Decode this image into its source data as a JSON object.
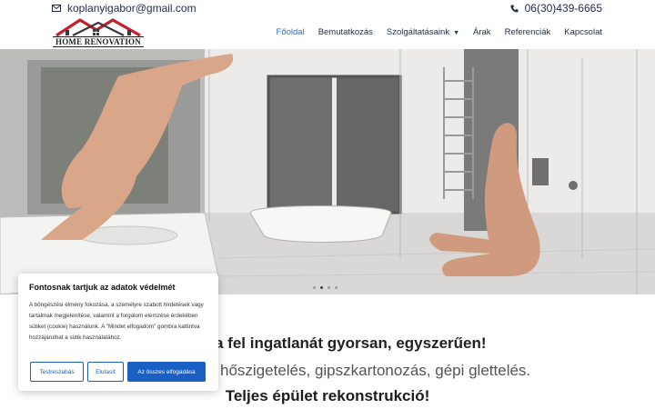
{
  "topbar": {
    "email": "koplanyigabor@gmail.com",
    "email_icon": "envelope-icon",
    "phone": "06(30)439-6665",
    "phone_icon": "phone-icon"
  },
  "logo": {
    "text": "HOME RENOVATION"
  },
  "nav": {
    "items": [
      {
        "label": "Főoldal",
        "active": true
      },
      {
        "label": "Bemutatkozás"
      },
      {
        "label": "Szolgáltatásaink",
        "has_dropdown": true
      },
      {
        "label": "Árak"
      },
      {
        "label": "Referenciák"
      },
      {
        "label": "Kapcsolat"
      }
    ]
  },
  "hero": {
    "slides": 4,
    "active_slide": 2
  },
  "tagline": {
    "line1": "a fel ingatlanát gyorsan, egyszerűen!",
    "line2": "hőszigetelés, gipszkartonozás, gépi glettelés.",
    "line3": "Teljes épület rekonstrukció!"
  },
  "cookie": {
    "title": "Fontosnak tartjuk az adatok védelmét",
    "body": "A böngészési élmény fokozása, a személyre szabott hirdetések vagy tartalmak megjelenítése, valamint a forgalom elemzése érdekében sütiket (cookie) használunk. A \"Mindet elfogadom\" gombra kattintva hozzájárulhat a sütik használatához.",
    "customize_label": "Testreszabás",
    "reject_label": "Elutasít",
    "accept_label": "Az összes elfogadása"
  },
  "colors": {
    "accent": "#1a5fc4",
    "nav_active": "#2a6ad0",
    "nav_text": "#1d2b4f",
    "logo_roof": "#c4202b"
  }
}
